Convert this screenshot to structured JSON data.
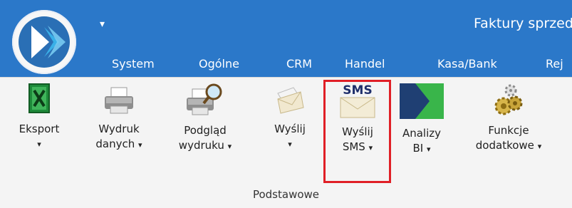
{
  "window": {
    "title": "Faktury sprzed",
    "quick_access_glyph": "▾",
    "logo_icon": "app-logo-icon"
  },
  "tabs": [
    {
      "label": "System"
    },
    {
      "label": "Ogólne"
    },
    {
      "label": "CRM"
    },
    {
      "label": "Handel"
    },
    {
      "label": "Kasa/Bank"
    },
    {
      "label": "Rej"
    }
  ],
  "ribbon": {
    "group_label": "Podstawowe",
    "caret": "▾",
    "buttons": [
      {
        "line1": "Eksport",
        "line2": "",
        "icon": "excel-icon"
      },
      {
        "line1": "Wydruk",
        "line2": "danych",
        "icon": "printer-icon"
      },
      {
        "line1": "Podgląd",
        "line2": "wydruku",
        "icon": "print-preview-icon"
      },
      {
        "line1": "Wyślij",
        "line2": "",
        "icon": "envelope-icon"
      },
      {
        "line1": "Wyślij",
        "line2": "SMS",
        "icon": "sms-envelope-icon",
        "sms_text": "SMS"
      },
      {
        "line1": "Analizy",
        "line2": "BI",
        "icon": "analytics-bi-icon"
      },
      {
        "line1": "Funkcje",
        "line2": "dodatkowe",
        "icon": "gears-icon"
      }
    ]
  },
  "colors": {
    "accent": "#2b78c9",
    "highlight": "#e01f26"
  }
}
